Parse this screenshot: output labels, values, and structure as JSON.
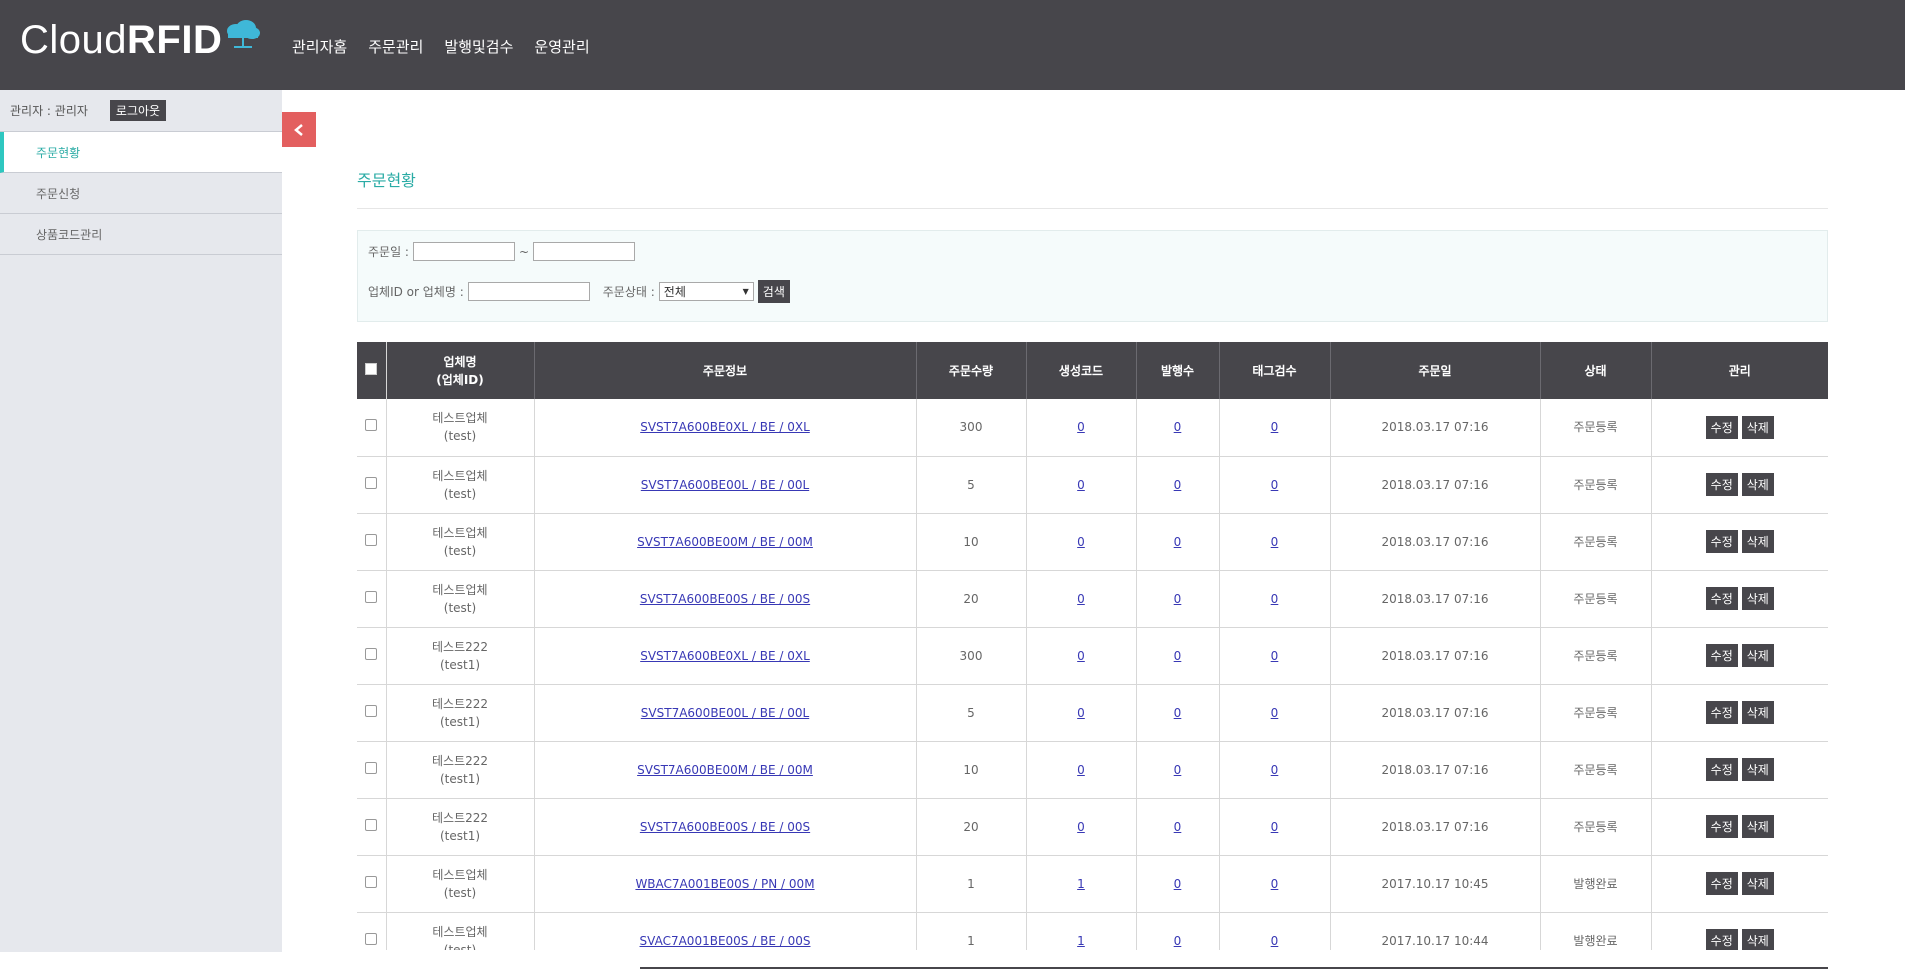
{
  "header": {
    "logo_text_light": "Cloud",
    "logo_text_bold": "RFID",
    "nav": [
      "관리자홈",
      "주문관리",
      "발행및검수",
      "운영관리"
    ]
  },
  "sidebar": {
    "user_label": "관리자 : 관리자",
    "logout_label": "로그아웃",
    "items": [
      {
        "label": "주문현황",
        "active": true
      },
      {
        "label": "주문신청",
        "active": false
      },
      {
        "label": "상품코드관리",
        "active": false
      }
    ]
  },
  "main": {
    "title": "주문현황",
    "search": {
      "order_date_label": "주문일 :",
      "range_sep": "~",
      "company_label": "업체ID or 업체명 :",
      "status_label": "주문상태 :",
      "status_value": "전체",
      "search_button": "검색"
    },
    "table": {
      "headers": {
        "company_line1": "업체명",
        "company_line2": "(업체ID)",
        "order_info": "주문정보",
        "quantity": "주문수량",
        "gen_code": "생성코드",
        "issued": "발행수",
        "tag_check": "태그검수",
        "order_date": "주문일",
        "status": "상태",
        "manage": "관리"
      },
      "edit_label": "수정",
      "delete_label": "삭제",
      "rows": [
        {
          "company": "테스트업체",
          "company_id": "(test)",
          "info": "SVST7A600BE0XL / BE / 0XL",
          "qty": "300",
          "gen": "0",
          "issued": "0",
          "tag": "0",
          "date": "2018.03.17 07:16",
          "status": "주문등록"
        },
        {
          "company": "테스트업체",
          "company_id": "(test)",
          "info": "SVST7A600BE00L / BE / 00L",
          "qty": "5",
          "gen": "0",
          "issued": "0",
          "tag": "0",
          "date": "2018.03.17 07:16",
          "status": "주문등록"
        },
        {
          "company": "테스트업체",
          "company_id": "(test)",
          "info": "SVST7A600BE00M / BE / 00M",
          "qty": "10",
          "gen": "0",
          "issued": "0",
          "tag": "0",
          "date": "2018.03.17 07:16",
          "status": "주문등록"
        },
        {
          "company": "테스트업체",
          "company_id": "(test)",
          "info": "SVST7A600BE00S / BE / 00S",
          "qty": "20",
          "gen": "0",
          "issued": "0",
          "tag": "0",
          "date": "2018.03.17 07:16",
          "status": "주문등록"
        },
        {
          "company": "테스트222",
          "company_id": "(test1)",
          "info": "SVST7A600BE0XL / BE / 0XL",
          "qty": "300",
          "gen": "0",
          "issued": "0",
          "tag": "0",
          "date": "2018.03.17 07:16",
          "status": "주문등록"
        },
        {
          "company": "테스트222",
          "company_id": "(test1)",
          "info": "SVST7A600BE00L / BE / 00L",
          "qty": "5",
          "gen": "0",
          "issued": "0",
          "tag": "0",
          "date": "2018.03.17 07:16",
          "status": "주문등록"
        },
        {
          "company": "테스트222",
          "company_id": "(test1)",
          "info": "SVST7A600BE00M / BE / 00M",
          "qty": "10",
          "gen": "0",
          "issued": "0",
          "tag": "0",
          "date": "2018.03.17 07:16",
          "status": "주문등록"
        },
        {
          "company": "테스트222",
          "company_id": "(test1)",
          "info": "SVST7A600BE00S / BE / 00S",
          "qty": "20",
          "gen": "0",
          "issued": "0",
          "tag": "0",
          "date": "2018.03.17 07:16",
          "status": "주문등록"
        },
        {
          "company": "테스트업체",
          "company_id": "(test)",
          "info": "WBAC7A001BE00S / PN / 00M",
          "qty": "1",
          "gen": "1",
          "issued": "0",
          "tag": "0",
          "date": "2017.10.17 10:45",
          "status": "발행완료"
        },
        {
          "company": "테스트업체",
          "company_id": "(test)",
          "info": "SVAC7A001BE00S / BE / 00S",
          "qty": "1",
          "gen": "1",
          "issued": "0",
          "tag": "0",
          "date": "2017.10.17 10:44",
          "status": "발행완료"
        }
      ]
    }
  },
  "colors": {
    "header_bg": "#47464b",
    "accent": "#2aaba5",
    "sidebar_bg": "#e6e8ed",
    "toggle": "#e35f5f",
    "link": "#3838b5"
  }
}
